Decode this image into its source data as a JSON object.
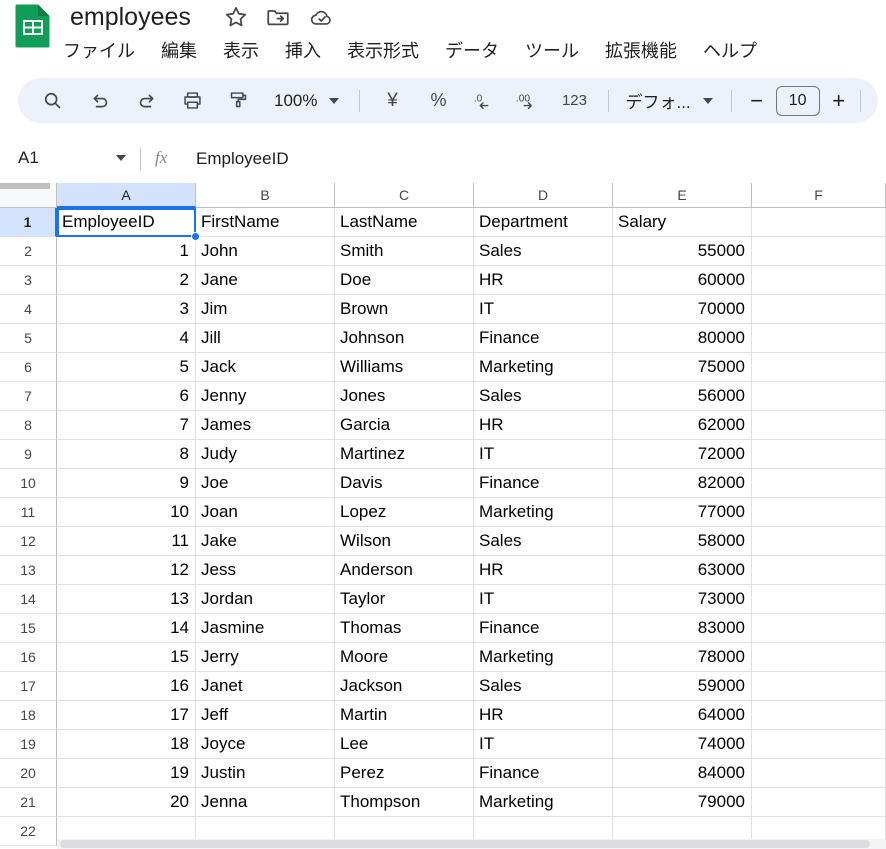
{
  "titlebar": {
    "doc_title": "employees",
    "icons": [
      {
        "name": "star-icon",
        "label": "Star"
      },
      {
        "name": "move-to-folder-icon",
        "label": "Move"
      },
      {
        "name": "cloud-saved-icon",
        "label": "Saved to Drive"
      }
    ]
  },
  "menubar": {
    "items": [
      {
        "label": "ファイル"
      },
      {
        "label": "編集"
      },
      {
        "label": "表示"
      },
      {
        "label": "挿入"
      },
      {
        "label": "表示形式"
      },
      {
        "label": "データ"
      },
      {
        "label": "ツール"
      },
      {
        "label": "拡張機能"
      },
      {
        "label": "ヘルプ"
      }
    ]
  },
  "toolbar": {
    "search_label": "search-icon",
    "undo_label": "undo-icon",
    "redo_label": "redo-icon",
    "print_label": "print-icon",
    "paint_label": "paint-format-icon",
    "zoom_value": "100%",
    "currency_label": "¥",
    "percent_label": "%",
    "decrease_decimal_label": ".0",
    "increase_decimal_label": ".00",
    "number_format_label": "123",
    "font_name": "デフォ...",
    "font_size_minus": "−",
    "font_size_value": "10",
    "font_size_plus": "+"
  },
  "formulabar": {
    "name_box_value": "A1",
    "fx_label": "fx",
    "formula_value": "EmployeeID"
  },
  "grid": {
    "columns": [
      "A",
      "B",
      "C",
      "D",
      "E",
      "F"
    ],
    "selected_column": "A",
    "selected_row": "1",
    "selected_cell": "A1",
    "row_numbers": [
      "1",
      "2",
      "3",
      "4",
      "5",
      "6",
      "7",
      "8",
      "9",
      "10",
      "11",
      "12",
      "13",
      "14",
      "15",
      "16",
      "17",
      "18",
      "19",
      "20",
      "21",
      "22"
    ],
    "header_row": [
      "EmployeeID",
      "FirstName",
      "LastName",
      "Department",
      "Salary",
      ""
    ],
    "rows": [
      [
        "1",
        "John",
        "Smith",
        "Sales",
        "55000",
        ""
      ],
      [
        "2",
        "Jane",
        "Doe",
        "HR",
        "60000",
        ""
      ],
      [
        "3",
        "Jim",
        "Brown",
        "IT",
        "70000",
        ""
      ],
      [
        "4",
        "Jill",
        "Johnson",
        "Finance",
        "80000",
        ""
      ],
      [
        "5",
        "Jack",
        "Williams",
        "Marketing",
        "75000",
        ""
      ],
      [
        "6",
        "Jenny",
        "Jones",
        "Sales",
        "56000",
        ""
      ],
      [
        "7",
        "James",
        "Garcia",
        "HR",
        "62000",
        ""
      ],
      [
        "8",
        "Judy",
        "Martinez",
        "IT",
        "72000",
        ""
      ],
      [
        "9",
        "Joe",
        "Davis",
        "Finance",
        "82000",
        ""
      ],
      [
        "10",
        "Joan",
        "Lopez",
        "Marketing",
        "77000",
        ""
      ],
      [
        "11",
        "Jake",
        "Wilson",
        "Sales",
        "58000",
        ""
      ],
      [
        "12",
        "Jess",
        "Anderson",
        "HR",
        "63000",
        ""
      ],
      [
        "13",
        "Jordan",
        "Taylor",
        "IT",
        "73000",
        ""
      ],
      [
        "14",
        "Jasmine",
        "Thomas",
        "Finance",
        "83000",
        ""
      ],
      [
        "15",
        "Jerry",
        "Moore",
        "Marketing",
        "78000",
        ""
      ],
      [
        "16",
        "Janet",
        "Jackson",
        "Sales",
        "59000",
        ""
      ],
      [
        "17",
        "Jeff",
        "Martin",
        "HR",
        "64000",
        ""
      ],
      [
        "18",
        "Joyce",
        "Lee",
        "IT",
        "74000",
        ""
      ],
      [
        "19",
        "Justin",
        "Perez",
        "Finance",
        "84000",
        ""
      ],
      [
        "20",
        "Jenna",
        "Thompson",
        "Marketing",
        "79000",
        ""
      ],
      [
        "",
        "",
        "",
        "",
        "",
        ""
      ]
    ],
    "numeric_columns": [
      0,
      4
    ]
  },
  "colors": {
    "brand_green": "#0f9d58",
    "selection_blue": "#1a73e8",
    "toolbar_bg": "#edf2fa",
    "header_selected_bg": "#d3e3fd"
  }
}
